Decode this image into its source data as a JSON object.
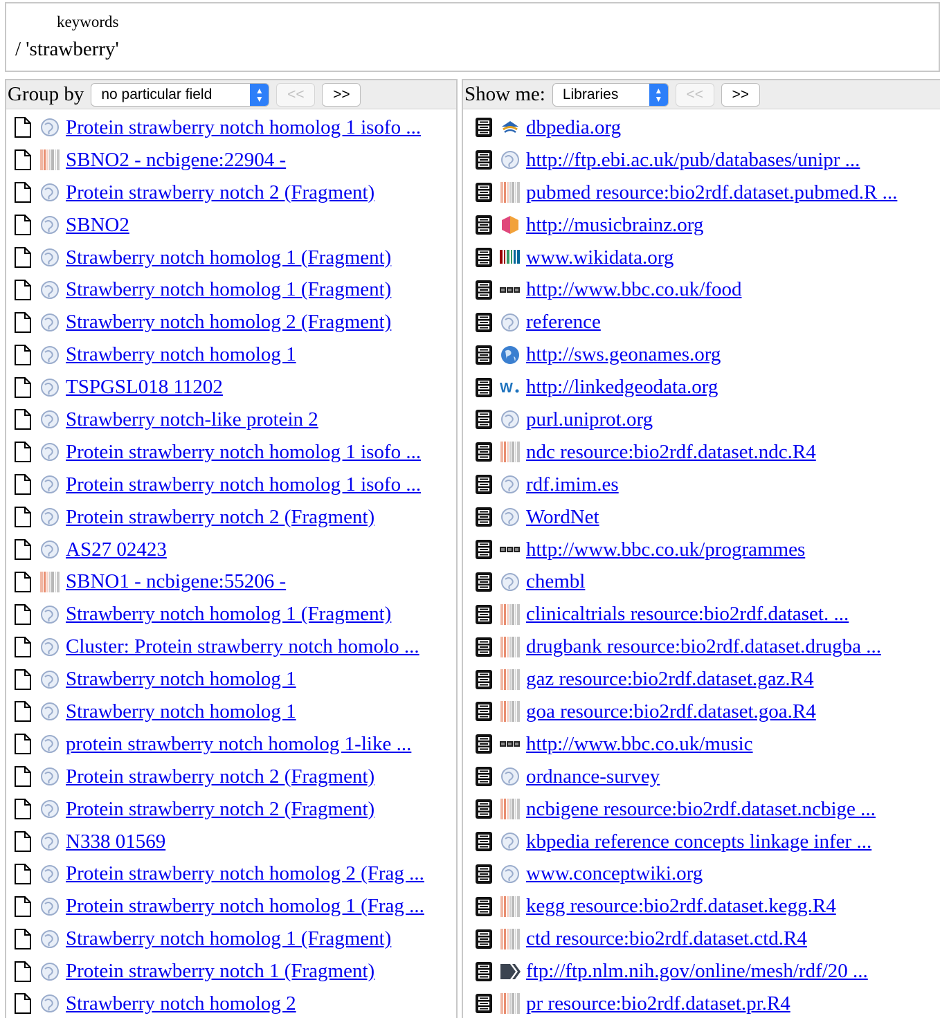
{
  "query": {
    "field_label": "keywords",
    "value": "/ 'strawberry'"
  },
  "left_panel": {
    "group_by_label": "Group by",
    "group_by_select": "no particular field",
    "prev_label": "<<",
    "next_label": ">>",
    "results": [
      {
        "icon": "globe-icon",
        "title": "Protein strawberry notch homolog 1 isofo ..."
      },
      {
        "icon": "barcode-icon",
        "title": "SBNO2 - ncbigene:22904 -"
      },
      {
        "icon": "globe-icon",
        "title": "Protein strawberry notch 2 (Fragment)"
      },
      {
        "icon": "globe-icon",
        "title": "SBNO2"
      },
      {
        "icon": "globe-icon",
        "title": "Strawberry notch homolog 1 (Fragment)"
      },
      {
        "icon": "globe-icon",
        "title": "Strawberry notch homolog 1 (Fragment)"
      },
      {
        "icon": "globe-icon",
        "title": "Strawberry notch homolog 2 (Fragment)"
      },
      {
        "icon": "globe-icon",
        "title": "Strawberry notch homolog 1"
      },
      {
        "icon": "globe-icon",
        "title": "TSPGSL018 11202"
      },
      {
        "icon": "globe-icon",
        "title": "Strawberry notch-like protein 2"
      },
      {
        "icon": "globe-icon",
        "title": "Protein strawberry notch homolog 1 isofo ..."
      },
      {
        "icon": "globe-icon",
        "title": "Protein strawberry notch homolog 1 isofo ..."
      },
      {
        "icon": "globe-icon",
        "title": "Protein strawberry notch 2 (Fragment)"
      },
      {
        "icon": "globe-icon",
        "title": "AS27 02423"
      },
      {
        "icon": "barcode-icon",
        "title": "SBNO1 - ncbigene:55206 -"
      },
      {
        "icon": "globe-icon",
        "title": "Strawberry notch homolog 1 (Fragment)"
      },
      {
        "icon": "globe-icon",
        "title": "Cluster: Protein strawberry notch homolo ..."
      },
      {
        "icon": "globe-icon",
        "title": "Strawberry notch homolog 1"
      },
      {
        "icon": "globe-icon",
        "title": "Strawberry notch homolog 1"
      },
      {
        "icon": "globe-icon",
        "title": "protein strawberry notch homolog 1-like ..."
      },
      {
        "icon": "globe-icon",
        "title": "Protein strawberry notch 2 (Fragment)"
      },
      {
        "icon": "globe-icon",
        "title": "Protein strawberry notch 2 (Fragment)"
      },
      {
        "icon": "globe-icon",
        "title": "N338 01569"
      },
      {
        "icon": "globe-icon",
        "title": "Protein strawberry notch homolog 2 (Frag ..."
      },
      {
        "icon": "globe-icon",
        "title": "Protein strawberry notch homolog 1 (Frag ..."
      },
      {
        "icon": "globe-icon",
        "title": "Strawberry notch homolog 1 (Fragment)"
      },
      {
        "icon": "globe-icon",
        "title": "Protein strawberry notch 1 (Fragment)"
      },
      {
        "icon": "globe-icon",
        "title": "Strawberry notch homolog 2"
      }
    ]
  },
  "right_panel": {
    "show_me_label": "Show me:",
    "show_me_select": "Libraries",
    "prev_label": "<<",
    "next_label": ">>",
    "libraries": [
      {
        "icon": "dbpedia-icon",
        "title": "dbpedia.org"
      },
      {
        "icon": "globe-icon",
        "title": "http://ftp.ebi.ac.uk/pub/databases/unipr ..."
      },
      {
        "icon": "barcode-icon",
        "title": "pubmed resource:bio2rdf.dataset.pubmed.R ..."
      },
      {
        "icon": "musicbrainz-icon",
        "title": "http://musicbrainz.org"
      },
      {
        "icon": "wikidata-icon",
        "title": "www.wikidata.org"
      },
      {
        "icon": "bbc-icon",
        "title": "http://www.bbc.co.uk/food"
      },
      {
        "icon": "globe-icon",
        "title": "reference"
      },
      {
        "icon": "earth-icon",
        "title": "http://sws.geonames.org"
      },
      {
        "icon": "linkedgeodata-icon",
        "title": "http://linkedgeodata.org"
      },
      {
        "icon": "globe-icon",
        "title": "purl.uniprot.org"
      },
      {
        "icon": "barcode-icon",
        "title": "ndc resource:bio2rdf.dataset.ndc.R4"
      },
      {
        "icon": "globe-icon",
        "title": "rdf.imim.es"
      },
      {
        "icon": "globe-icon",
        "title": "WordNet"
      },
      {
        "icon": "bbc-icon",
        "title": "http://www.bbc.co.uk/programmes"
      },
      {
        "icon": "globe-icon",
        "title": "chembl"
      },
      {
        "icon": "barcode-icon",
        "title": "clinicaltrials resource:bio2rdf.dataset. ..."
      },
      {
        "icon": "barcode-icon",
        "title": "drugbank resource:bio2rdf.dataset.drugba ..."
      },
      {
        "icon": "barcode-icon",
        "title": "gaz resource:bio2rdf.dataset.gaz.R4"
      },
      {
        "icon": "barcode-icon",
        "title": "goa resource:bio2rdf.dataset.goa.R4"
      },
      {
        "icon": "bbc-icon",
        "title": "http://www.bbc.co.uk/music"
      },
      {
        "icon": "globe-icon",
        "title": "ordnance-survey"
      },
      {
        "icon": "barcode-icon",
        "title": "ncbigene resource:bio2rdf.dataset.ncbige ..."
      },
      {
        "icon": "globe-icon",
        "title": "kbpedia reference concepts linkage infer ..."
      },
      {
        "icon": "globe-icon",
        "title": "www.conceptwiki.org"
      },
      {
        "icon": "barcode-icon",
        "title": "kegg resource:bio2rdf.dataset.kegg.R4"
      },
      {
        "icon": "barcode-icon",
        "title": "ctd resource:bio2rdf.dataset.ctd.R4"
      },
      {
        "icon": "mesh-icon",
        "title": "ftp://ftp.nlm.nih.gov/online/mesh/rdf/20 ..."
      },
      {
        "icon": "barcode-icon",
        "title": "pr resource:bio2rdf.dataset.pr.R4"
      }
    ]
  }
}
